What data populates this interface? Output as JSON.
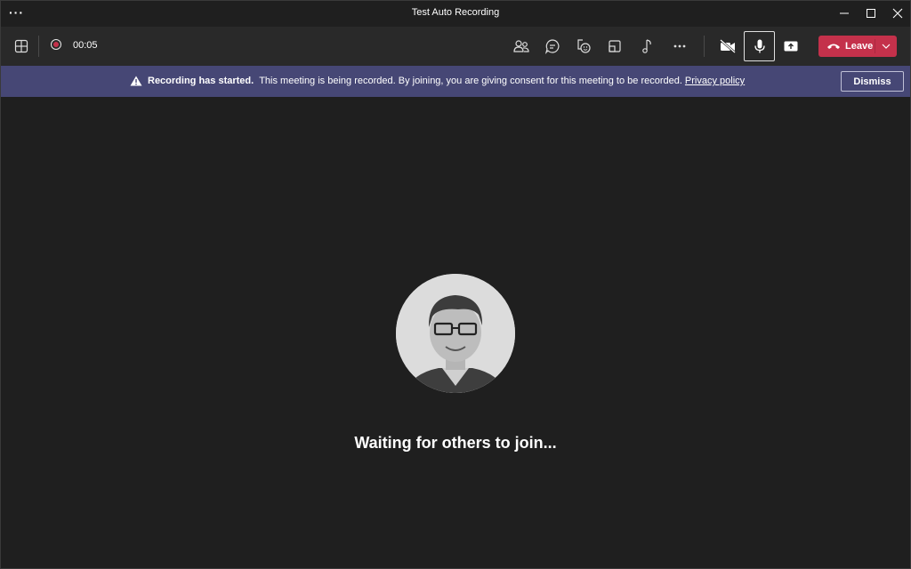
{
  "window": {
    "title": "Test Auto Recording",
    "more_label": "···"
  },
  "toolbar": {
    "timer": "00:05",
    "icons": [
      "layout-icon",
      "record-icon",
      "participants-icon",
      "chat-icon",
      "reactions-icon",
      "rooms-icon",
      "music-icon",
      "more-icon",
      "camera-off-icon",
      "mic-icon",
      "share-icon"
    ],
    "leave_label": "Leave"
  },
  "banner": {
    "title": "Recording has started.",
    "message": "This meeting is being recorded. By joining, you are giving consent for this meeting to be recorded.",
    "link": "Privacy policy",
    "dismiss_label": "Dismiss"
  },
  "stage": {
    "status": "Waiting for others to join..."
  },
  "colors": {
    "background": "#1f1f1f",
    "toolbar": "#292929",
    "banner": "#464775",
    "leave": "#c4314b"
  }
}
